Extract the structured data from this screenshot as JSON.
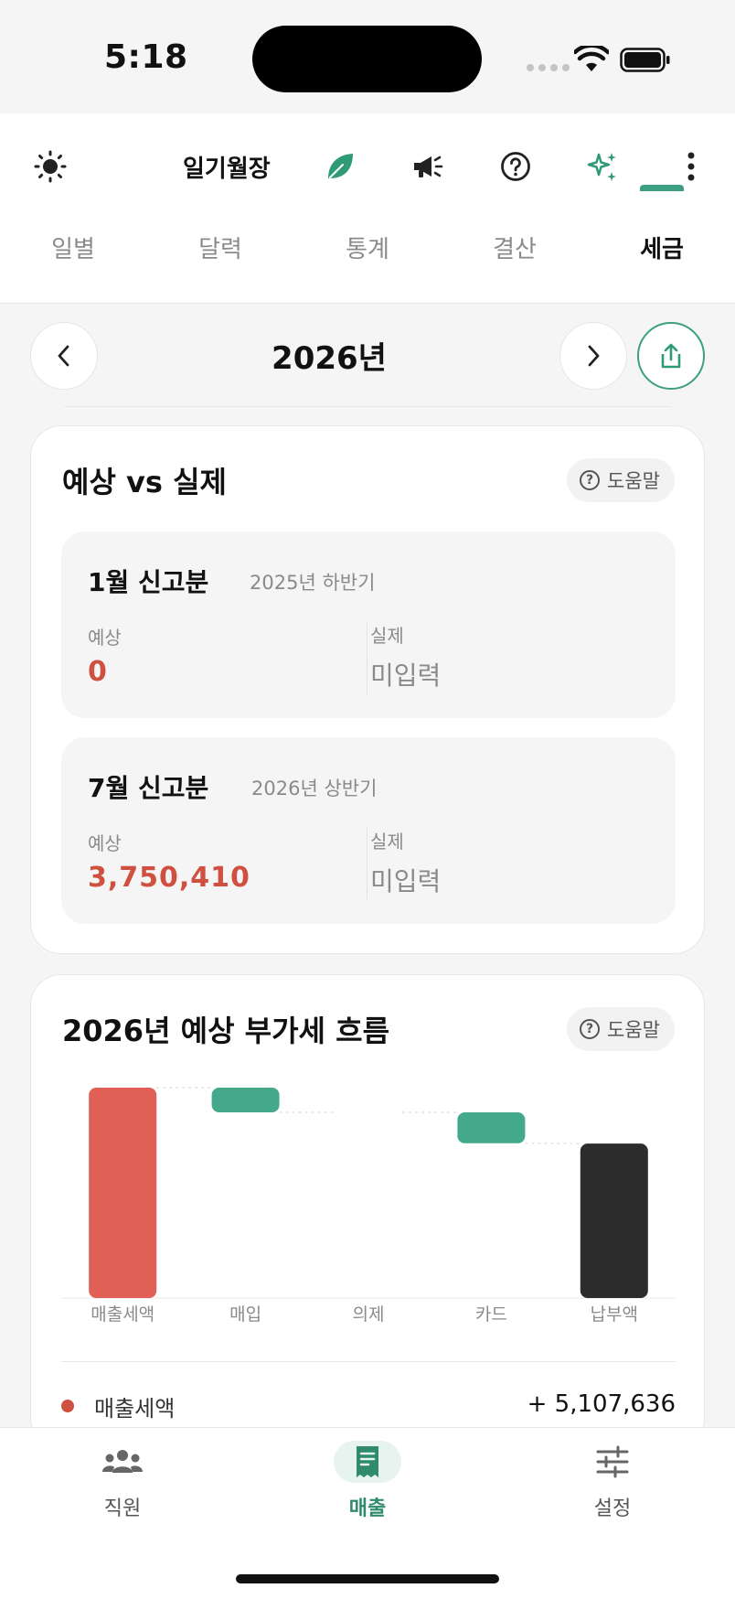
{
  "status_bar": {
    "time": "5:18"
  },
  "header": {
    "app_title": "일기월장",
    "icons": [
      "sun-icon",
      "leaf-icon",
      "megaphone-icon",
      "help-circle-icon",
      "sparkles-icon",
      "more-vertical-icon"
    ]
  },
  "tabs": [
    {
      "label": "일별",
      "active": false
    },
    {
      "label": "달력",
      "active": false
    },
    {
      "label": "통계",
      "active": false
    },
    {
      "label": "결산",
      "active": false
    },
    {
      "label": "세금",
      "active": true
    }
  ],
  "year_nav": {
    "year": "2026년"
  },
  "forecast_card": {
    "title": "예상 vs 실제",
    "help_label": "도움말",
    "periods": [
      {
        "title": "1월 신고분",
        "period": "2025년 하반기",
        "expected_label": "예상",
        "expected_value": "0",
        "actual_label": "실제",
        "actual_value": "미입력"
      },
      {
        "title": "7월 신고분",
        "period": "2026년 상반기",
        "expected_label": "예상",
        "expected_value": "3,750,410",
        "actual_label": "실제",
        "actual_value": "미입력"
      }
    ]
  },
  "flow_card": {
    "title": "2026년 예상 부가세 흐름",
    "help_label": "도움말",
    "legend": [
      {
        "name": "매출세액",
        "value": "+ 5,107,636",
        "color": "#d05040"
      }
    ]
  },
  "chart_data": {
    "type": "bar",
    "subtype": "waterfall",
    "categories": [
      "매출세액",
      "매입",
      "의제",
      "카드",
      "납부액"
    ],
    "values": [
      5107636,
      -600000,
      0,
      -750000,
      3750410
    ],
    "ylim": [
      0,
      5107636
    ],
    "colors": {
      "increase": "#e06055",
      "decrease": "#43a98a",
      "total": "#2c2c2c"
    },
    "grid": false
  },
  "bottom_nav": [
    {
      "label": "직원",
      "icon": "people-icon",
      "active": false
    },
    {
      "label": "매출",
      "icon": "receipt-icon",
      "active": true
    },
    {
      "label": "설정",
      "icon": "sliders-icon",
      "active": false
    }
  ]
}
